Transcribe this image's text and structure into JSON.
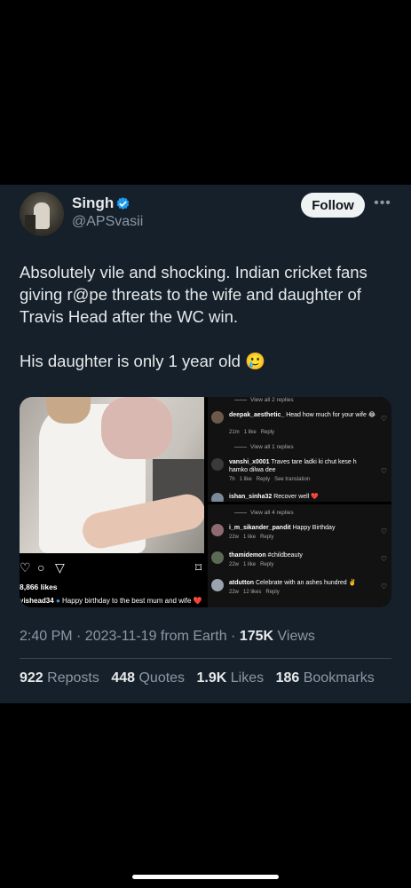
{
  "author": {
    "name": "Singh",
    "handle": "@APSvasii",
    "verified": true
  },
  "follow_label": "Follow",
  "more_label": "•••",
  "tweet": {
    "line1": "Absolutely vile and shocking. Indian cricket fans giving r@pe threats to the wife and daughter of Travis Head after the WC win.",
    "line2": "His daughter is only 1 year old 🥲"
  },
  "media": {
    "left": {
      "likes": "8,866 likes",
      "caption_user": "vishead34",
      "caption_text": "Happy birthday to the best mum and wife ❤️",
      "icons": [
        "heart-outline-icon",
        "comment-icon",
        "share-icon",
        "bookmark-icon"
      ]
    },
    "comments_top": {
      "view_all_1": "View all 2 replies",
      "comment1": {
        "user": "deepak_aesthetic_",
        "text": "Head how much for your wife 😂",
        "time": "21m",
        "likes": "1 like",
        "reply": "Reply"
      },
      "view_all_2": "View all 1 replies",
      "comment2": {
        "user": "vanshi_x0001",
        "text": "Traves tare ladki ki chut kese h hamko dilwa dee",
        "time": "7h",
        "likes": "1 like",
        "reply": "Reply",
        "translate": "See translation"
      },
      "comment3": {
        "user": "ishan_sinha32",
        "text": "Recover well ❤️"
      }
    },
    "comments_bottom": {
      "view_all": "View all 4 replies",
      "comment1": {
        "user": "i_m_sikander_pandit",
        "text": "Happy Birthday",
        "time": "22w",
        "likes": "1 like",
        "reply": "Reply"
      },
      "comment2": {
        "user": "thamidemon",
        "text": "#childbeauty",
        "time": "22w",
        "likes": "1 like",
        "reply": "Reply"
      },
      "comment3": {
        "user": "atdutton",
        "text": "Celebrate with an ashes hundred ✌️",
        "time": "22w",
        "likes": "12 likes",
        "reply": "Reply"
      }
    }
  },
  "timestamp": "2:40 PM · 2023-11-19 from Earth · ",
  "views_count": "175K",
  "views_label": " Views",
  "stats": [
    {
      "count": "922",
      "label": "Reposts"
    },
    {
      "count": "448",
      "label": "Quotes"
    },
    {
      "count": "1.9K",
      "label": "Likes"
    },
    {
      "count": "186",
      "label": "Bookmarks"
    }
  ],
  "colors": {
    "background": "#15202b",
    "verified_blue": "#1d9bf0",
    "secondary_text": "#8b98a5"
  }
}
